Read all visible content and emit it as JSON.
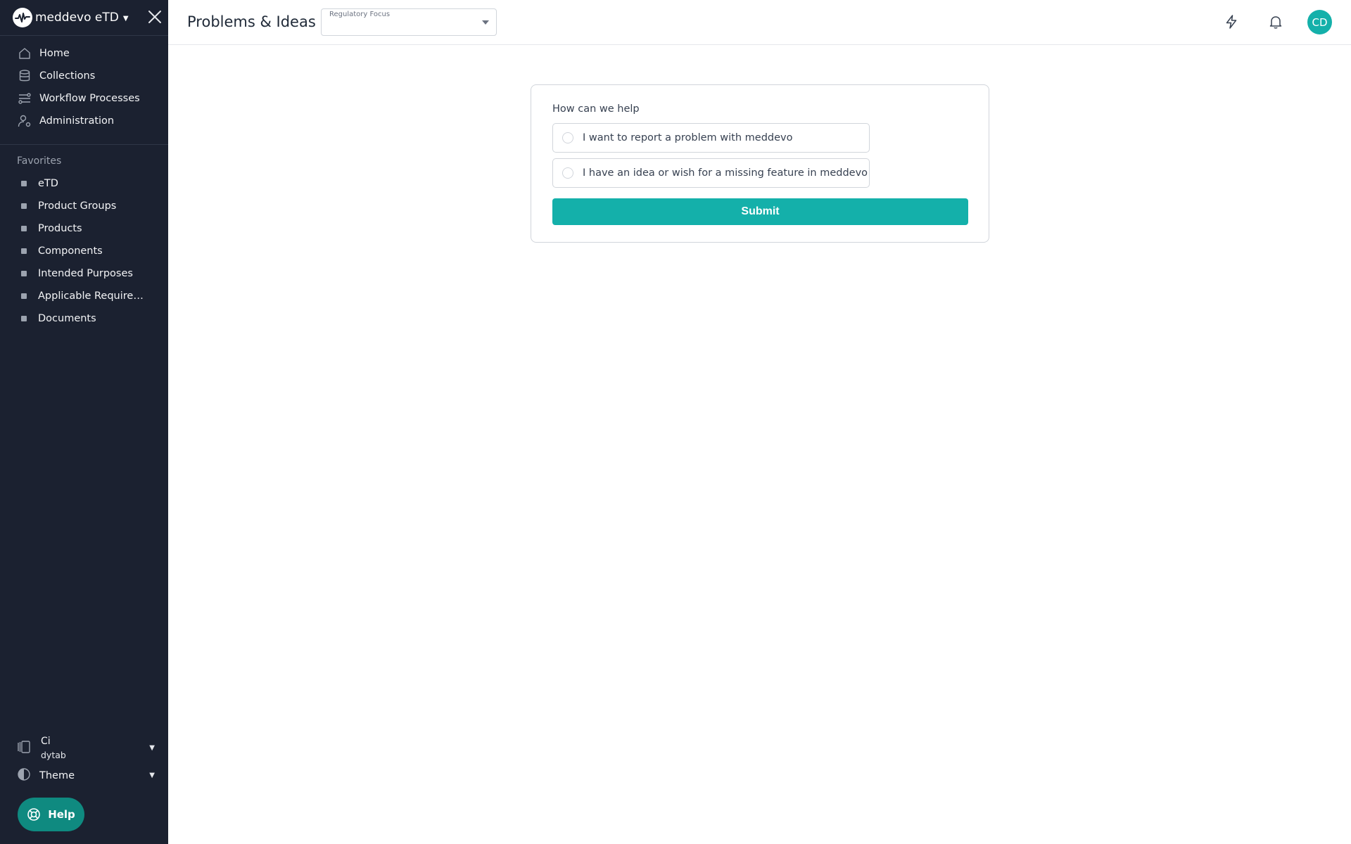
{
  "sidebar": {
    "brand": "meddevo eTD",
    "nav": [
      {
        "label": "Home",
        "icon": "home-icon"
      },
      {
        "label": "Collections",
        "icon": "database-icon"
      },
      {
        "label": "Workflow Processes",
        "icon": "workflow-icon"
      },
      {
        "label": "Administration",
        "icon": "user-gear-icon"
      }
    ],
    "favorites_title": "Favorites",
    "favorites": [
      {
        "label": "eTD"
      },
      {
        "label": "Product Groups"
      },
      {
        "label": "Products"
      },
      {
        "label": "Components"
      },
      {
        "label": "Intended Purposes"
      },
      {
        "label": "Applicable Requirem..."
      },
      {
        "label": "Documents"
      }
    ],
    "tenant": {
      "name": "Ci",
      "sub": "dytab"
    },
    "theme_label": "Theme",
    "help_label": "Help"
  },
  "header": {
    "title": "Problems & Ideas",
    "select_label": "Regulatory Focus",
    "select_value": "",
    "avatar_initials": "CD"
  },
  "form": {
    "title": "How can we help",
    "options": [
      {
        "label": "I want to report a problem with meddevo"
      },
      {
        "label": "I have an idea or wish for a missing feature in meddevo"
      }
    ],
    "submit_label": "Submit"
  },
  "colors": {
    "sidebar_bg": "#1b2130",
    "accent": "#14b0aa",
    "help_bg": "#0f8a80"
  }
}
